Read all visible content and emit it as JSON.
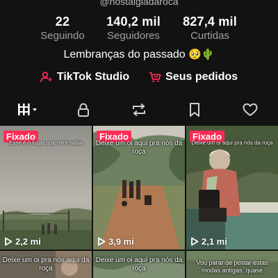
{
  "profile": {
    "handle": "@nostalgiadaroca"
  },
  "stats": [
    {
      "value": "22",
      "label": "Seguindo"
    },
    {
      "value": "140,2 mil",
      "label": "Seguidores"
    },
    {
      "value": "827,4 mil",
      "label": "Curtidas"
    }
  ],
  "bio": {
    "text": "Lembranças do passado",
    "emojis": "🥺🌵"
  },
  "links": {
    "studio_label": "TikTok Studio",
    "orders_label": "Seus pedidos",
    "accent_color": "#fe2c55"
  },
  "tabs": [
    {
      "icon": "grid-icon",
      "active": true
    },
    {
      "icon": "lock-icon"
    },
    {
      "icon": "repost-icon"
    },
    {
      "icon": "bookmark-icon"
    },
    {
      "icon": "heart-icon"
    }
  ],
  "videos": [
    {
      "pinned_label": "Fixado",
      "caption": "Esse é o lugar que nem sabia",
      "views": "2,2 mi"
    },
    {
      "pinned_label": "Fixado",
      "caption": "Deixe um oi aqui pra nós da roça",
      "views": "3,9 mi"
    },
    {
      "pinned_label": "Fixado",
      "caption": "Deixe um oi aqui pra nós da roça",
      "views": "2,1 mi"
    },
    {
      "caption": "Deixe um oi pra nós aqui da roça",
      "views": ""
    },
    {
      "caption": "Deixe um oi aqui pra nós da roça",
      "views": ""
    },
    {
      "caption": "Vou parar de postar estas modas antigas, quase",
      "views": ""
    }
  ]
}
